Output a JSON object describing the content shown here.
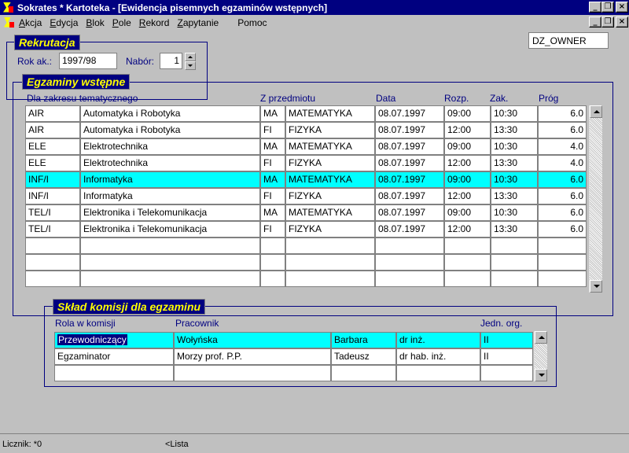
{
  "window": {
    "title": "Sokrates * Kartoteka - [Ewidencja pisemnych egzaminów wstępnych]"
  },
  "menu": [
    {
      "label": "Akcja",
      "u": "A",
      "rest": "kcja"
    },
    {
      "label": "Edycja",
      "u": "E",
      "rest": "dycja"
    },
    {
      "label": "Blok",
      "u": "B",
      "rest": "lok"
    },
    {
      "label": "Pole",
      "u": "P",
      "rest": "ole"
    },
    {
      "label": "Rekord",
      "u": "R",
      "rest": "ekord"
    },
    {
      "label": "Zapytanie",
      "u": "Z",
      "rest": "apytanie"
    },
    {
      "label": "Pomoc",
      "u": "",
      "rest": "Pomoc"
    }
  ],
  "owner": "DZ_OWNER",
  "rekrutacja": {
    "title": "Rekrutacja",
    "rok_label": "Rok ak.:",
    "rok_value": "1997/98",
    "nabor_label": "Nabór:",
    "nabor_value": "1"
  },
  "egzaminy": {
    "title": "Egzaminy wstępne",
    "headers": {
      "zakres": "Dla zakresu tematycznego",
      "przedmiot": "Z przedmiotu",
      "data": "Data",
      "rozp": "Rozp.",
      "zak": "Zak.",
      "prog": "Próg"
    },
    "rows": [
      {
        "code": "AIR",
        "name": "Automatyka i Robotyka",
        "subj": "MA",
        "subj_name": "MATEMATYKA",
        "date": "08.07.1997",
        "start": "09:00",
        "end": "10:30",
        "threshold": "6.0"
      },
      {
        "code": "AIR",
        "name": "Automatyka i Robotyka",
        "subj": "FI",
        "subj_name": "FIZYKA",
        "date": "08.07.1997",
        "start": "12:00",
        "end": "13:30",
        "threshold": "6.0"
      },
      {
        "code": "ELE",
        "name": "Elektrotechnika",
        "subj": "MA",
        "subj_name": "MATEMATYKA",
        "date": "08.07.1997",
        "start": "09:00",
        "end": "10:30",
        "threshold": "4.0"
      },
      {
        "code": "ELE",
        "name": "Elektrotechnika",
        "subj": "FI",
        "subj_name": "FIZYKA",
        "date": "08.07.1997",
        "start": "12:00",
        "end": "13:30",
        "threshold": "4.0"
      },
      {
        "code": "INF/I",
        "name": "Informatyka",
        "subj": "MA",
        "subj_name": "MATEMATYKA",
        "date": "08.07.1997",
        "start": "09:00",
        "end": "10:30",
        "threshold": "6.0",
        "selected": true
      },
      {
        "code": "INF/I",
        "name": "Informatyka",
        "subj": "FI",
        "subj_name": "FIZYKA",
        "date": "08.07.1997",
        "start": "12:00",
        "end": "13:30",
        "threshold": "6.0"
      },
      {
        "code": "TEL/I",
        "name": "Elektronika i Telekomunikacja",
        "subj": "MA",
        "subj_name": "MATEMATYKA",
        "date": "08.07.1997",
        "start": "09:00",
        "end": "10:30",
        "threshold": "6.0"
      },
      {
        "code": "TEL/I",
        "name": "Elektronika i Telekomunikacja",
        "subj": "FI",
        "subj_name": "FIZYKA",
        "date": "08.07.1997",
        "start": "12:00",
        "end": "13:30",
        "threshold": "6.0"
      },
      {
        "code": "",
        "name": "",
        "subj": "",
        "subj_name": "",
        "date": "",
        "start": "",
        "end": "",
        "threshold": ""
      },
      {
        "code": "",
        "name": "",
        "subj": "",
        "subj_name": "",
        "date": "",
        "start": "",
        "end": "",
        "threshold": ""
      },
      {
        "code": "",
        "name": "",
        "subj": "",
        "subj_name": "",
        "date": "",
        "start": "",
        "end": "",
        "threshold": ""
      }
    ]
  },
  "komisja": {
    "title": "Skład komisji dla egzaminu",
    "headers": {
      "rola": "Rola w komisji",
      "pracownik": "Pracownik",
      "jedn": "Jedn. org."
    },
    "rows": [
      {
        "role": "Przewodniczący",
        "surname": "Wołyńska",
        "first": "Barbara",
        "title": "dr inż.",
        "unit": "II",
        "selected": true
      },
      {
        "role": "Egzaminator",
        "surname": "Morzy prof. P.P.",
        "first": "Tadeusz",
        "title": "dr hab. inż.",
        "unit": "II"
      },
      {
        "role": "",
        "surname": "",
        "first": "",
        "title": "",
        "unit": ""
      }
    ]
  },
  "status": {
    "counter": "Licznik: *0",
    "mode": "<Lista"
  }
}
